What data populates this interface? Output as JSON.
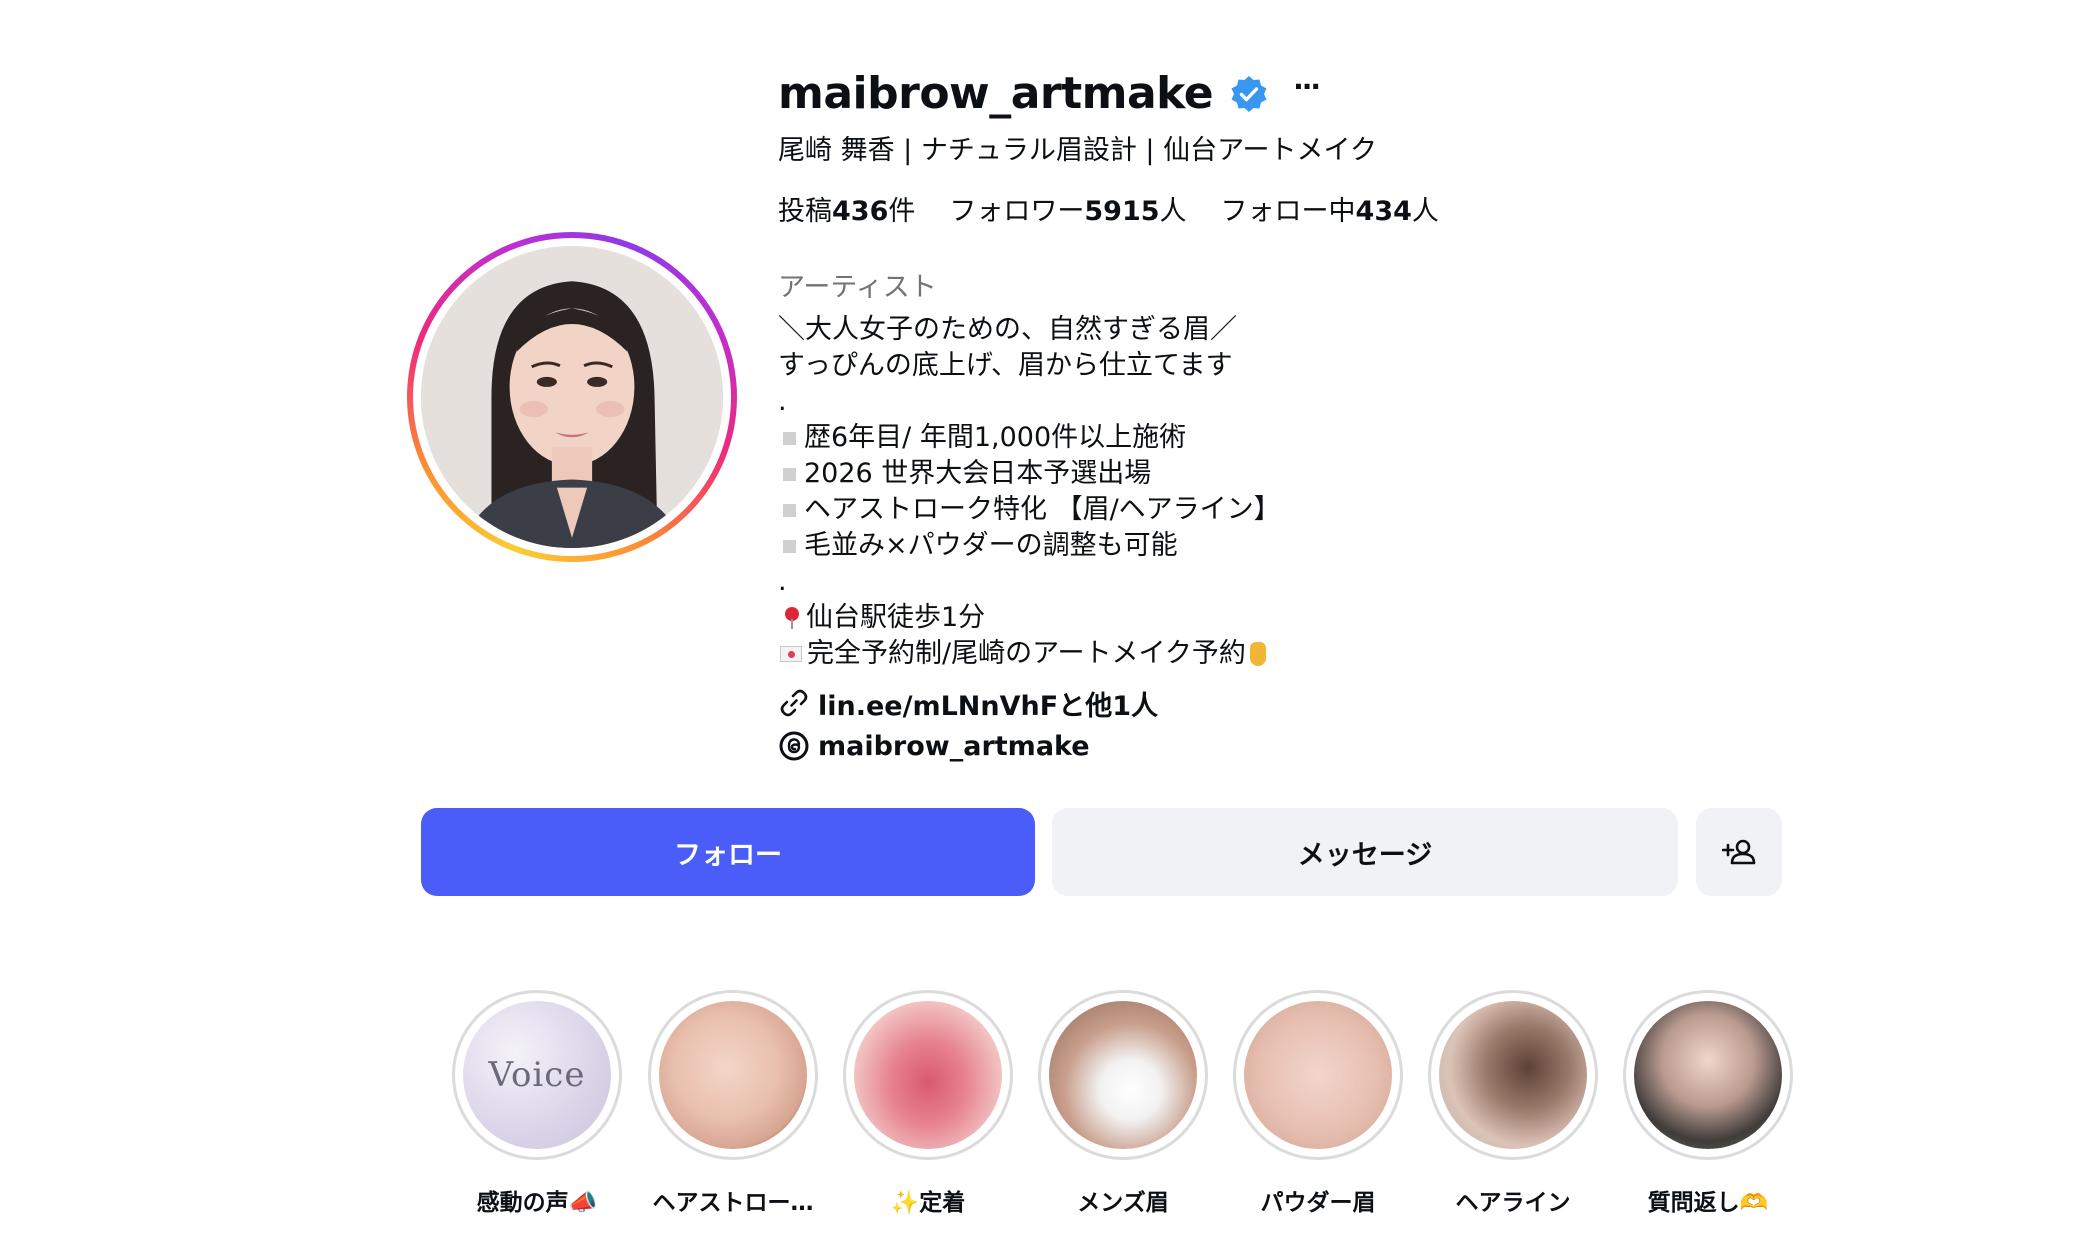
{
  "profile": {
    "username": "maibrow_artmake",
    "full_name": "尾崎 舞香 | ナチュラル眉設計 | 仙台アートメイク",
    "verified_icon": "verified-badge-icon",
    "more_icon": "more-options-icon",
    "more_label": "···",
    "category": "アーティスト"
  },
  "stats": {
    "posts_label": "投稿",
    "posts_count": "436",
    "posts_unit": "件",
    "followers_label": "フォロワー",
    "followers_count": "5915",
    "followers_unit": "人",
    "following_label": "フォロー中",
    "following_count": "434",
    "following_unit": "人"
  },
  "bio": {
    "line1": "＼大人女子のための、自然すぎる眉／",
    "line2": "すっぴんの底上げ、眉から仕立てます",
    "dot1": ".",
    "bullet1": "歴6年目/ 年間1,000件以上施術",
    "bullet2": "2026 世界大会日本予選出場",
    "bullet3": "ヘアストローク特化 【眉/ヘアライン】",
    "bullet4": "毛並み×パウダーの調整も可能",
    "dot2": ".",
    "location": "仙台駅徒歩1分",
    "booking": "完全予約制/尾崎のアートメイク予約"
  },
  "links": {
    "website": "lin.ee/mLNnVhFと他1人",
    "threads": "maibrow_artmake"
  },
  "buttons": {
    "follow": "フォロー",
    "message": "メッセージ",
    "suggest_icon": "add-person-icon"
  },
  "highlights": [
    {
      "label": "感動の声📣",
      "cover_text": "Voice"
    },
    {
      "label": "ヘアストロー…"
    },
    {
      "label": "✨定着"
    },
    {
      "label": "メンズ眉"
    },
    {
      "label": "パウダー眉"
    },
    {
      "label": "ヘアライン"
    },
    {
      "label": "質問返し🫶"
    }
  ],
  "colors": {
    "follow_button": "#4a5df9",
    "secondary_button": "#f0f2f5",
    "verified_blue": "#3897f0",
    "category_gray": "#737373"
  }
}
